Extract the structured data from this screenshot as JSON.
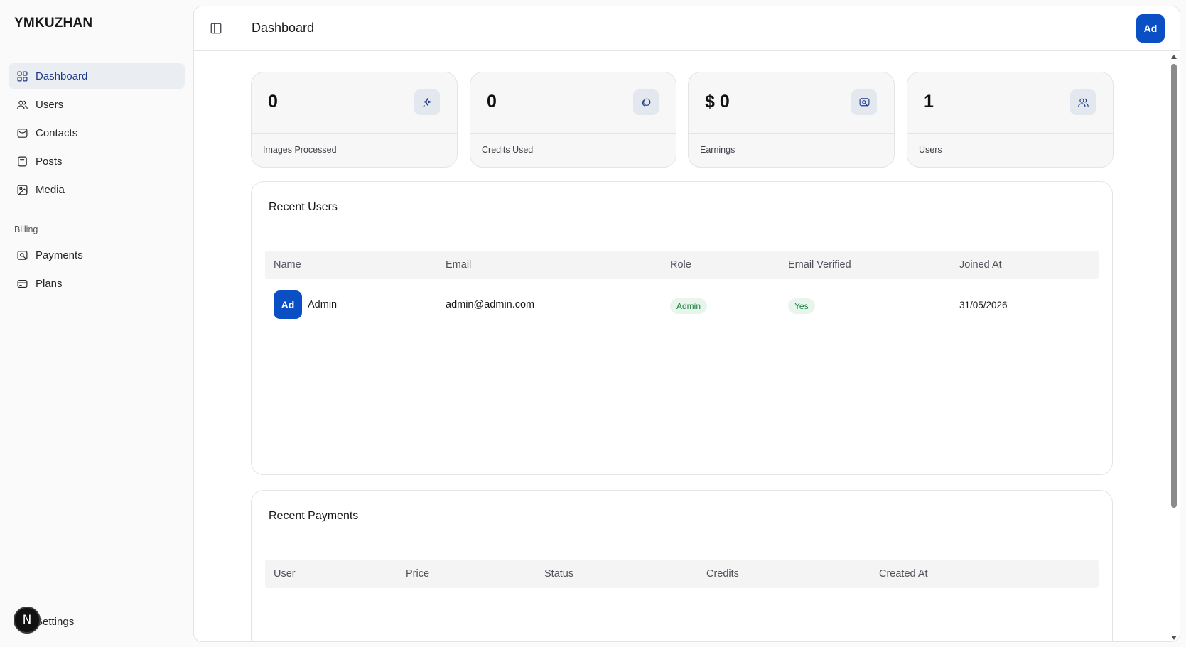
{
  "sidebar": {
    "brand": "YMKUZHAN",
    "items": [
      {
        "label": "Dashboard",
        "icon": "grid-icon"
      },
      {
        "label": "Users",
        "icon": "users-icon"
      },
      {
        "label": "Contacts",
        "icon": "message-icon"
      },
      {
        "label": "Posts",
        "icon": "document-icon"
      },
      {
        "label": "Media",
        "icon": "image-icon"
      }
    ],
    "billing_label": "Billing",
    "billing_items": [
      {
        "label": "Payments",
        "icon": "payment-icon"
      },
      {
        "label": "Plans",
        "icon": "card-icon"
      }
    ],
    "settings_label": "Settings",
    "badge_letter": "N"
  },
  "header": {
    "title": "Dashboard",
    "avatar_initials": "Ad"
  },
  "stats": [
    {
      "value": "0",
      "label": "Images Processed",
      "icon": "sparkle-icon"
    },
    {
      "value": "0",
      "label": "Credits Used",
      "icon": "coin-icon"
    },
    {
      "value": "$ 0",
      "label": "Earnings",
      "icon": "money-icon"
    },
    {
      "value": "1",
      "label": "Users",
      "icon": "users-icon"
    }
  ],
  "recent_users": {
    "title": "Recent Users",
    "columns": [
      "Name",
      "Email",
      "Role",
      "Email Verified",
      "Joined At"
    ],
    "rows": [
      {
        "initials": "Ad",
        "name": "Admin",
        "email": "admin@admin.com",
        "role": "Admin",
        "verified": "Yes",
        "joined": "31/05/2026"
      }
    ]
  },
  "recent_payments": {
    "title": "Recent Payments",
    "columns": [
      "User",
      "Price",
      "Status",
      "Credits",
      "Created At"
    ]
  },
  "colors": {
    "accent": "#0b4fc4",
    "active_nav_bg": "#eaeef3",
    "badge_green_bg": "#e8f5ec",
    "badge_green_text": "#15803d"
  }
}
